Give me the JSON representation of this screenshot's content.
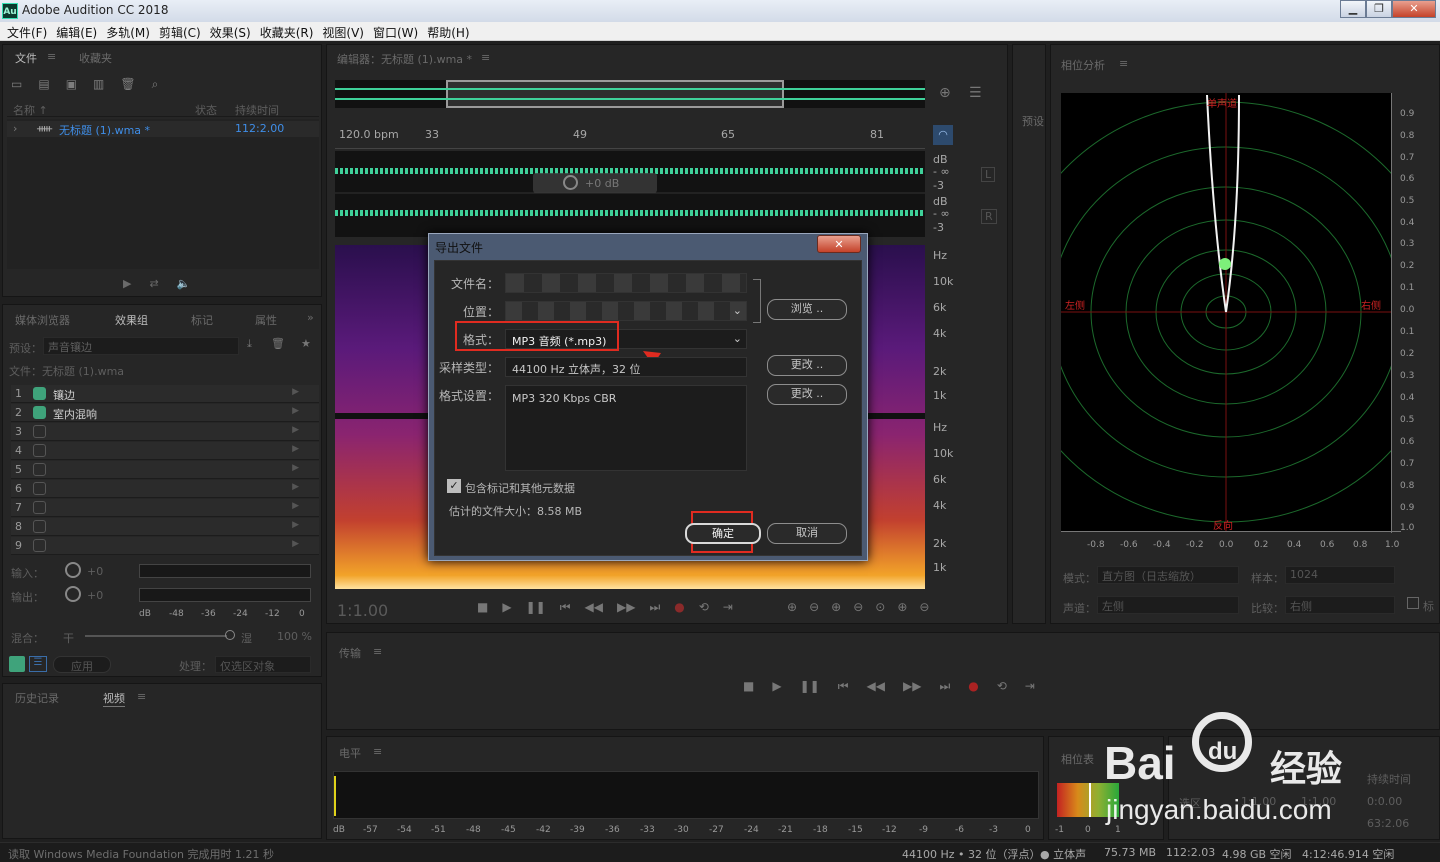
{
  "app": {
    "logo": "Au",
    "title": "Adobe Audition CC 2018",
    "win_min": "▁",
    "win_max": "❐",
    "win_close": "✕"
  },
  "menu": [
    "文件(F)",
    "编辑(E)",
    "多轨(M)",
    "剪辑(C)",
    "效果(S)",
    "收藏夹(R)",
    "视图(V)",
    "窗口(W)",
    "帮助(H)"
  ],
  "files_panel": {
    "tab_files": "文件",
    "tab_favorites": "收藏夹",
    "col_name": "名称 ↑",
    "col_status": "状态",
    "col_duration": "持续时间",
    "file_name": "无标题 (1).wma *",
    "file_duration": "112:2.00"
  },
  "effects_panel": {
    "tabs": [
      "媒体浏览器",
      "效果组",
      "标记",
      "属性"
    ],
    "preset_label": "预设：",
    "preset_value": "声音镶边",
    "file_label": "文件：无标题 (1).wma",
    "racks": [
      {
        "n": "1",
        "name": "镶边"
      },
      {
        "n": "2",
        "name": "室内混响"
      },
      {
        "n": "3",
        "name": ""
      },
      {
        "n": "4",
        "name": ""
      },
      {
        "n": "5",
        "name": ""
      },
      {
        "n": "6",
        "name": ""
      },
      {
        "n": "7",
        "name": ""
      },
      {
        "n": "8",
        "name": ""
      },
      {
        "n": "9",
        "name": ""
      }
    ],
    "input_label": "输入：",
    "output_label": "输出：",
    "gain_in": "+0",
    "gain_out": "+0",
    "meter_ticks": [
      "dB",
      "-48",
      "-36",
      "-24",
      "-12",
      "0"
    ],
    "mix_label": "混合：",
    "mix_dry": "干",
    "mix_wet": "湿",
    "mix_pct": "100 %",
    "apply": "应用",
    "process_label": "处理：",
    "process_value": "仅选区对象"
  },
  "history_panel": {
    "tab_history": "历史记录",
    "tab_video": "视频"
  },
  "editor": {
    "tab": "编辑器：无标题 (1).wma *",
    "bpm": "120.0 bpm",
    "ruler": [
      "33",
      "49",
      "65",
      "81"
    ],
    "db_labels": [
      "dB",
      "- ∞",
      "-3"
    ],
    "hz_labels": [
      "Hz",
      "10k",
      "6k",
      "4k",
      "2k",
      "1k"
    ],
    "ch_l": "L",
    "ch_r": "R",
    "hud_value": "+0 dB",
    "time": "1:1.00",
    "presets_tab": "预设"
  },
  "transport": {
    "title": "传输"
  },
  "levels": {
    "title": "电平",
    "ticks": [
      "dB",
      "-57",
      "-54",
      "-51",
      "-48",
      "-45",
      "-42",
      "-39",
      "-36",
      "-33",
      "-30",
      "-27",
      "-24",
      "-21",
      "-18",
      "-15",
      "-12",
      "-9",
      "-6",
      "-3",
      "0"
    ]
  },
  "phase": {
    "title": "相位分析",
    "top_label": "单声道",
    "left_label": "左侧",
    "right_label": "右侧",
    "bottom_label": "反向",
    "y_ticks": [
      "0.9",
      "0.8",
      "0.7",
      "0.6",
      "0.5",
      "0.4",
      "0.3",
      "0.2",
      "0.1",
      "0.0",
      "0.1",
      "0.2",
      "0.3",
      "0.4",
      "0.5",
      "0.6",
      "0.7",
      "0.8",
      "0.9",
      "1.0"
    ],
    "x_ticks": [
      "-0.8",
      "-0.6",
      "-0.4",
      "-0.2",
      "0.0",
      "0.2",
      "0.4",
      "0.6",
      "0.8",
      "1.0"
    ],
    "mode_label": "模式：",
    "mode_value": "直方图（日志缩放）",
    "sample_label": "样本：",
    "sample_value": "1024",
    "channel_label": "声道：",
    "channel_value": "左侧",
    "compare_label": "比较：",
    "compare_value": "右侧",
    "marker_label": "标"
  },
  "phase_meter": {
    "title": "相位表",
    "scale": [
      "-1",
      "0",
      "1"
    ]
  },
  "selection": {
    "col_sel": "选区",
    "col_start": "1:1.00",
    "col_end": "1:1.00",
    "col_dur_title": "持续时间",
    "col_dur": "0:0.00",
    "total": "63:2.06"
  },
  "dialog": {
    "title": "导出文件",
    "filename_label": "文件名：",
    "location_label": "位置：",
    "format_label": "格式：",
    "format_value": "MP3 音频 (*.mp3)",
    "sample_label": "采样类型：",
    "sample_value": "44100 Hz 立体声，32 位",
    "settings_label": "格式设置：",
    "settings_value": "MP3 320 Kbps CBR",
    "browse": "浏览 ..",
    "change1": "更改 ..",
    "change2": "更改 ..",
    "include_markers": "包含标记和其他元数据",
    "estimated": "估计的文件大小：8.58 MB",
    "ok": "确定",
    "cancel": "取消"
  },
  "status": {
    "left": "读取 Windows Media Foundation 完成用时 1.21 秒",
    "format": "44100 Hz • 32 位（浮点）",
    "channels": "● 立体声",
    "size": "75.73 MB",
    "duration": "112:2.03",
    "free": "4.98 GB 空闲",
    "free_time": "4:12:46.914 空闲"
  },
  "watermark": {
    "brand": "Bai",
    "paw": "du",
    "jy": "经验",
    "url": "jingyan.baidu.com"
  },
  "colors": {
    "accent": "#3fa37b",
    "wave": "#3fd19a",
    "highlight": "#e02b20",
    "selection": "#4b5a72"
  }
}
